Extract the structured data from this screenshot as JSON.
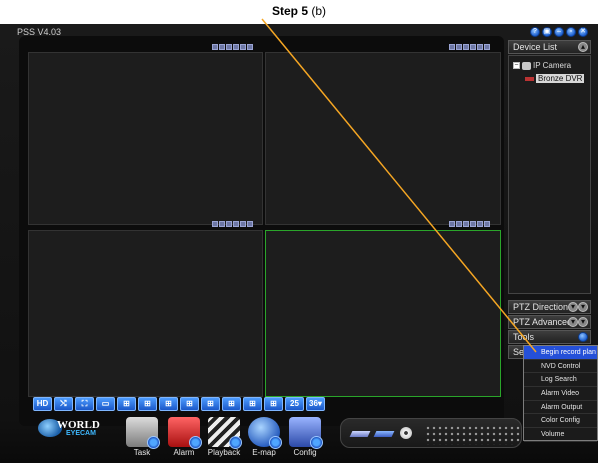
{
  "caption": {
    "step_bold": "Step 5",
    "step_rest": "(b)"
  },
  "app": {
    "title": "PSS  V4.03"
  },
  "window_controls": [
    "?",
    "▣",
    "–",
    "▫",
    "✕"
  ],
  "toolbar": {
    "hd_label": "HD",
    "buttons": [
      "HD",
      "⤭",
      "⛶",
      "▭",
      "⊞",
      "⊞",
      "⊞",
      "⊞",
      "⊞",
      "⊞",
      "⊞",
      "⊞",
      "25",
      "36▾"
    ]
  },
  "sidebar": {
    "device_list_label": "Device List",
    "tree": {
      "root_label": "IP Camera",
      "child_label": "Bronze DVR"
    },
    "ptz_direction_label": "PTZ Direction",
    "ptz_advanced_label": "PTZ Advanced",
    "tools_label": "Tools",
    "setting_label": "Se"
  },
  "context_menu": {
    "items": [
      "Begin record plan",
      "NVD Control",
      "Log Search",
      "Alarm Video",
      "Alarm Output",
      "Color Config",
      "Volume"
    ],
    "highlighted_index": 0
  },
  "launchers": [
    "Task",
    "Alarm",
    "Playback",
    "E-map",
    "Config"
  ],
  "logo": {
    "line1": "WORLD",
    "line2": "EYECAM"
  },
  "colors": {
    "active_cell_border": "#2aa52a",
    "arrow": "#f5a623",
    "menu_highlight": "#2550d8"
  }
}
